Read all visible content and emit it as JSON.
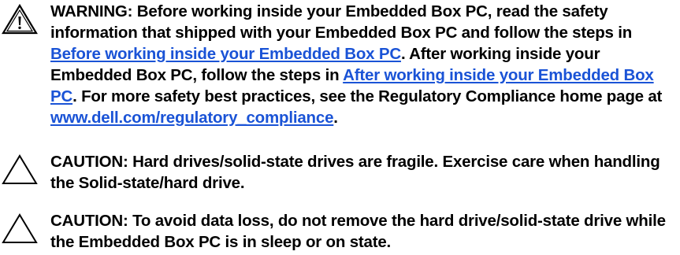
{
  "warning": {
    "icon": "warning-triangle-icon",
    "prefix": "WARNING: Before working inside your Embedded Box PC, read the safety information that shipped with your Embedded Box PC and follow the steps in ",
    "link1": "Before working inside your Embedded Box PC",
    "mid": ". After working inside your Embedded Box PC, follow the steps in ",
    "link2": "After working inside your Embedded Box PC",
    "mid2": ". For more safety best practices, see the Regulatory Compliance home page at ",
    "link3": "www.dell.com/regulatory_compliance",
    "suffix": "."
  },
  "caution1": {
    "icon": "caution-triangle-icon",
    "text": "CAUTION: Hard drives/solid-state drives are fragile. Exercise care when handling the Solid-state/hard drive."
  },
  "caution2": {
    "icon": "caution-triangle-icon",
    "text": "CAUTION: To avoid data loss, do not remove the hard drive/solid-state drive while the Embedded Box PC is in sleep or on state."
  },
  "colors": {
    "text": "#000000",
    "link": "#1a53d6",
    "background": "#ffffff"
  }
}
